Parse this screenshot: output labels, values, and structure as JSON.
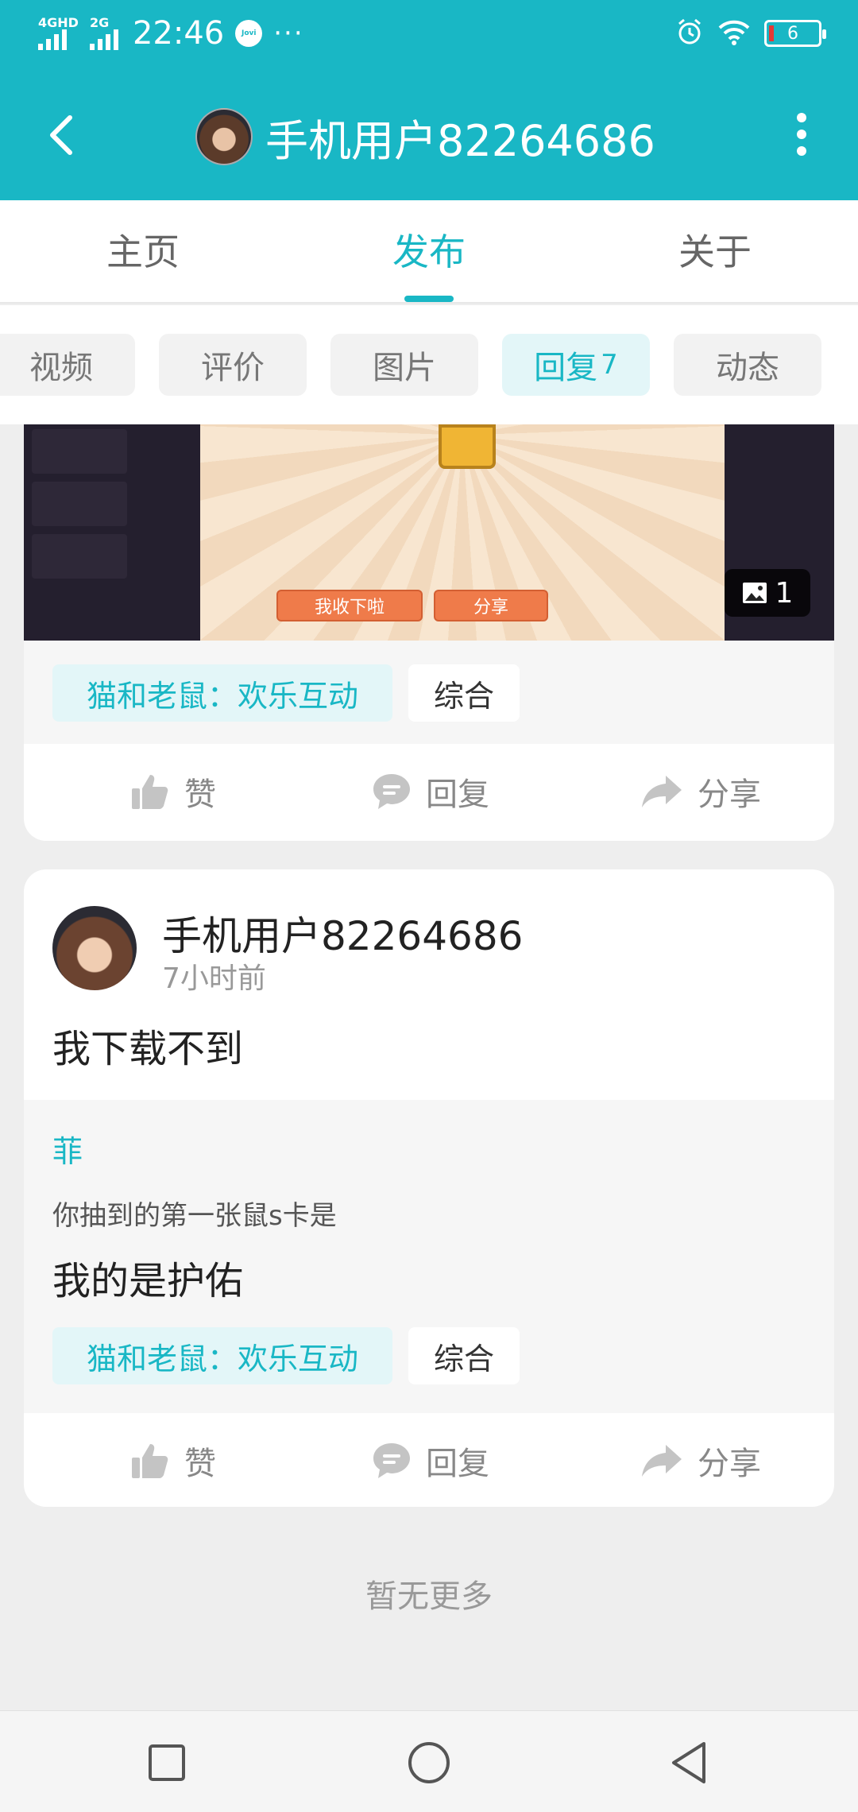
{
  "status_bar": {
    "network_1": "4GHD",
    "network_2": "2G",
    "time": "22:46",
    "jovi_label": "Jovi",
    "more": "···",
    "battery": "6"
  },
  "header": {
    "title": "手机用户82264686",
    "icons": [
      "back-arrow-icon",
      "avatar",
      "more-vertical-icon"
    ]
  },
  "tabs": [
    {
      "label": "主页",
      "active": false
    },
    {
      "label": "发布",
      "active": true
    },
    {
      "label": "关于",
      "active": false
    }
  ],
  "subtabs": [
    {
      "label": "视频",
      "count": "",
      "active": false
    },
    {
      "label": "评价",
      "count": "",
      "active": false
    },
    {
      "label": "图片",
      "count": "",
      "active": false
    },
    {
      "label": "回复",
      "count": "7",
      "active": true
    },
    {
      "label": "动态",
      "count": "",
      "active": false
    }
  ],
  "post1": {
    "image_buttons": [
      "我收下啦",
      "分享"
    ],
    "image_count": "1",
    "game_tag": "猫和老鼠：欢乐互动",
    "category_tag": "综合",
    "actions": {
      "like": "赞",
      "reply": "回复",
      "share": "分享"
    }
  },
  "post2": {
    "username": "手机用户82264686",
    "time": "7小时前",
    "content": "我下载不到",
    "quote": {
      "author": "菲",
      "title": "你抽到的第一张鼠s卡是",
      "body": "我的是护佑"
    },
    "game_tag": "猫和老鼠：欢乐互动",
    "category_tag": "综合",
    "actions": {
      "like": "赞",
      "reply": "回复",
      "share": "分享"
    }
  },
  "footer_text": "暂无更多",
  "colors": {
    "accent": "#19b7c5",
    "background": "#eeeeee",
    "tag_bg": "#e3f6f8"
  }
}
